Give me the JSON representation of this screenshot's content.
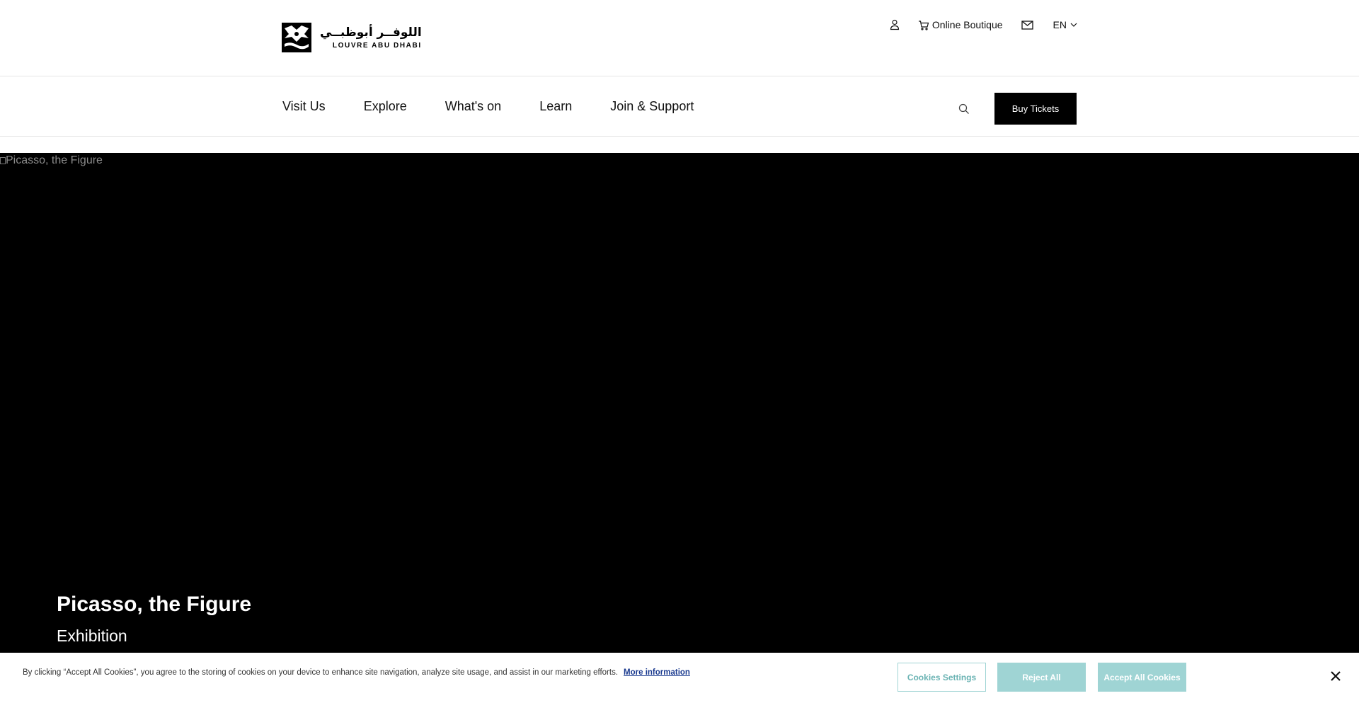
{
  "logo": {
    "arabic": "اللوفــر أبوظبــي",
    "english": "LOUVRE ABU DHABI"
  },
  "utility": {
    "account_icon": "user-icon",
    "boutique_icon": "cart-icon",
    "boutique_label": "Online Boutique",
    "mail_icon": "mail-icon",
    "language": "EN"
  },
  "nav": {
    "items": [
      {
        "label": "Visit Us"
      },
      {
        "label": "Explore"
      },
      {
        "label": "What's on"
      },
      {
        "label": "Learn"
      },
      {
        "label": "Join & Support"
      }
    ],
    "search_icon": "search-icon",
    "buy_tickets": "Buy Tickets"
  },
  "hero": {
    "image_alt": "Picasso, the Figure",
    "title": "Picasso, the Figure",
    "subtitle": "Exhibition"
  },
  "cookie": {
    "text": "By clicking “Accept All Cookies”, you agree to the storing of cookies on your device to enhance site navigation, analyze site usage, and assist in our marketing efforts.",
    "more_info": "More information",
    "settings": "Cookies Settings",
    "reject": "Reject All",
    "accept": "Accept All Cookies"
  },
  "colors": {
    "primary": "#000000",
    "cookie_button": "#9fd4d4",
    "cookie_link": "#1a3a8f"
  }
}
